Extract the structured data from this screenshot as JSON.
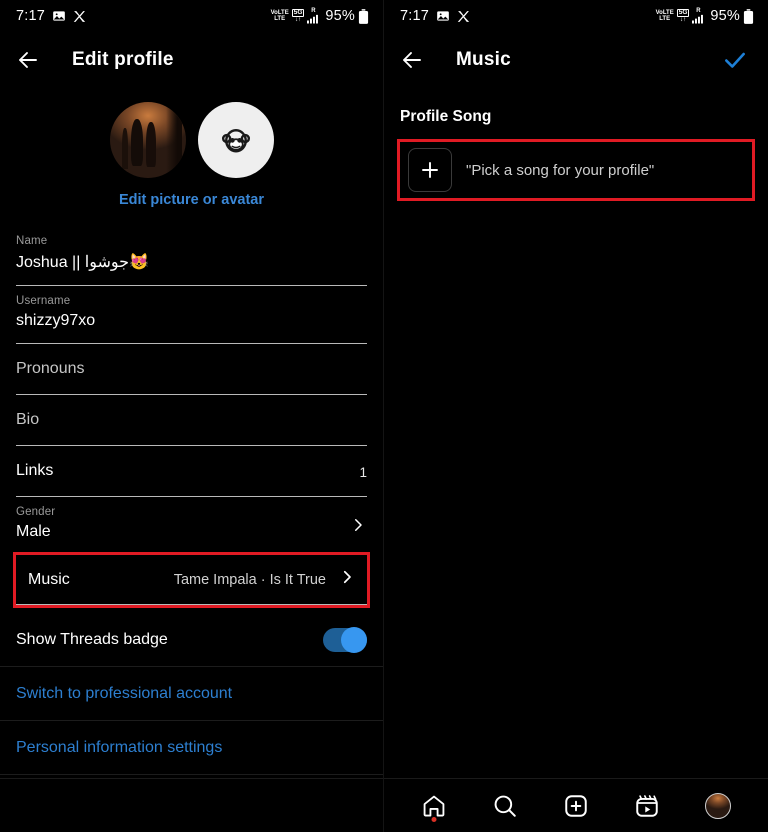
{
  "status_bar": {
    "time": "7:17",
    "icons_left": [
      "photo-icon",
      "x-app-icon"
    ],
    "volte_top": "VoLTE",
    "volte_bot": "LTE",
    "network_top": "5G",
    "network_bot": "↓↑",
    "roaming": "R",
    "signal": "signal-bars-icon",
    "battery_pct": "95%",
    "battery": "battery-icon"
  },
  "left_panel": {
    "appbar": {
      "back_icon": "arrow-left-icon",
      "title": "Edit profile"
    },
    "avatars": {
      "profile_photo_name": "profile-photo",
      "avatar_name": "monkey-avatar",
      "edit_link": "Edit picture or avatar"
    },
    "fields": [
      {
        "label": "Name",
        "value": "Joshua || جوشوا😻",
        "type": "text"
      },
      {
        "label": "Username",
        "value": "shizzy97xo",
        "type": "text"
      },
      {
        "label": "Pronouns",
        "value": "",
        "type": "placeholder",
        "placeholder": "Pronouns"
      },
      {
        "label": "Bio",
        "value": "",
        "type": "placeholder",
        "placeholder": "Bio"
      }
    ],
    "links_row": {
      "label": "Links",
      "count": "1"
    },
    "gender_row": {
      "label": "Gender",
      "value": "Male",
      "chevron": "chevron-right-icon"
    },
    "music_row": {
      "label": "Music",
      "value": "Tame Impala · Is It True",
      "chevron": "chevron-right-icon",
      "highlighted": true,
      "highlight_color": "#e01b24"
    },
    "threads_row": {
      "label": "Show Threads badge",
      "toggle_on": true,
      "toggle_color": "#3797f0"
    },
    "links": [
      {
        "label": "Switch to professional account",
        "color": "#2d7fd0"
      },
      {
        "label": "Personal information settings",
        "color": "#2d7fd0"
      }
    ]
  },
  "right_panel": {
    "appbar": {
      "back_icon": "arrow-left-icon",
      "title": "Music",
      "confirm_icon": "check-icon",
      "confirm_color": "#1d7fd6"
    },
    "section_title": "Profile Song",
    "song_row": {
      "add_icon": "plus-icon",
      "text": "\"Pick a song for your profile\"",
      "highlighted": true,
      "highlight_color": "#e01b24"
    },
    "bottom_nav": [
      {
        "name": "home",
        "icon": "home-icon",
        "badge_dot": true
      },
      {
        "name": "search",
        "icon": "search-icon",
        "badge_dot": false
      },
      {
        "name": "create",
        "icon": "plus-square-icon",
        "badge_dot": false
      },
      {
        "name": "reels",
        "icon": "reels-icon",
        "badge_dot": false
      },
      {
        "name": "profile",
        "icon": "profile-avatar-icon",
        "badge_dot": false
      }
    ]
  }
}
